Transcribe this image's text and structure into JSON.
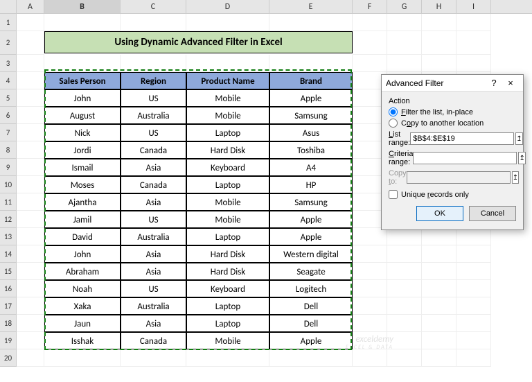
{
  "columns_letters": [
    "A",
    "B",
    "C",
    "D",
    "E",
    "F",
    "G",
    "H",
    "I"
  ],
  "selected_column": "B",
  "row_count": 20,
  "title": "Using Dynamic Advanced Filter in Excel",
  "headers": [
    "Sales Person",
    "Region",
    "Product Name",
    "Brand"
  ],
  "rows": [
    [
      "John",
      "US",
      "Mobile",
      "Apple"
    ],
    [
      "August",
      "Australia",
      "Mobile",
      "Samsung"
    ],
    [
      "Nick",
      "US",
      "Laptop",
      "Asus"
    ],
    [
      "Jordi",
      "Canada",
      "Hard Disk",
      "Toshiba"
    ],
    [
      "Ismail",
      "Asia",
      "Keyboard",
      "A4"
    ],
    [
      "Moses",
      "Canada",
      "Laptop",
      "HP"
    ],
    [
      "Ajantha",
      "Asia",
      "Mobile",
      "Samsung"
    ],
    [
      "Jamil",
      "US",
      "Mobile",
      "Apple"
    ],
    [
      "David",
      "Australia",
      "Laptop",
      "Apple"
    ],
    [
      "John",
      "Asia",
      "Hard Disk",
      "Western digital"
    ],
    [
      "Abraham",
      "Asia",
      "Hard Disk",
      "Seagate"
    ],
    [
      "Noah",
      "US",
      "Keyboard",
      "Logitech"
    ],
    [
      "Xaka",
      "Australia",
      "Laptop",
      "Dell"
    ],
    [
      "Jaun",
      "Asia",
      "Laptop",
      "Dell"
    ],
    [
      "Isshak",
      "Canada",
      "Mobile",
      "Apple"
    ]
  ],
  "dialog": {
    "title": "Advanced Filter",
    "help": "?",
    "close": "×",
    "action_label": "Action",
    "radio1": "Filter the list, in-place",
    "radio2": "Copy to another location",
    "list_range_label": "List range:",
    "list_range_value": "$B$4:$E$19",
    "criteria_label": "Criteria range:",
    "criteria_value": "",
    "copyto_label": "Copy to:",
    "copyto_value": "",
    "unique_label": "Unique records only",
    "ok": "OK",
    "cancel": "Cancel",
    "ref_icon": "↥"
  },
  "watermark": {
    "line1": "exceldemy",
    "line2": "EXCEL & DATA"
  },
  "chart_data": {
    "type": "table",
    "title": "Using Dynamic Advanced Filter in Excel",
    "columns": [
      "Sales Person",
      "Region",
      "Product Name",
      "Brand"
    ],
    "data": [
      [
        "John",
        "US",
        "Mobile",
        "Apple"
      ],
      [
        "August",
        "Australia",
        "Mobile",
        "Samsung"
      ],
      [
        "Nick",
        "US",
        "Laptop",
        "Asus"
      ],
      [
        "Jordi",
        "Canada",
        "Hard Disk",
        "Toshiba"
      ],
      [
        "Ismail",
        "Asia",
        "Keyboard",
        "A4"
      ],
      [
        "Moses",
        "Canada",
        "Laptop",
        "HP"
      ],
      [
        "Ajantha",
        "Asia",
        "Mobile",
        "Samsung"
      ],
      [
        "Jamil",
        "US",
        "Mobile",
        "Apple"
      ],
      [
        "David",
        "Australia",
        "Laptop",
        "Apple"
      ],
      [
        "John",
        "Asia",
        "Hard Disk",
        "Western digital"
      ],
      [
        "Abraham",
        "Asia",
        "Hard Disk",
        "Seagate"
      ],
      [
        "Noah",
        "US",
        "Keyboard",
        "Logitech"
      ],
      [
        "Xaka",
        "Australia",
        "Laptop",
        "Dell"
      ],
      [
        "Jaun",
        "Asia",
        "Laptop",
        "Dell"
      ],
      [
        "Isshak",
        "Canada",
        "Mobile",
        "Apple"
      ]
    ]
  }
}
